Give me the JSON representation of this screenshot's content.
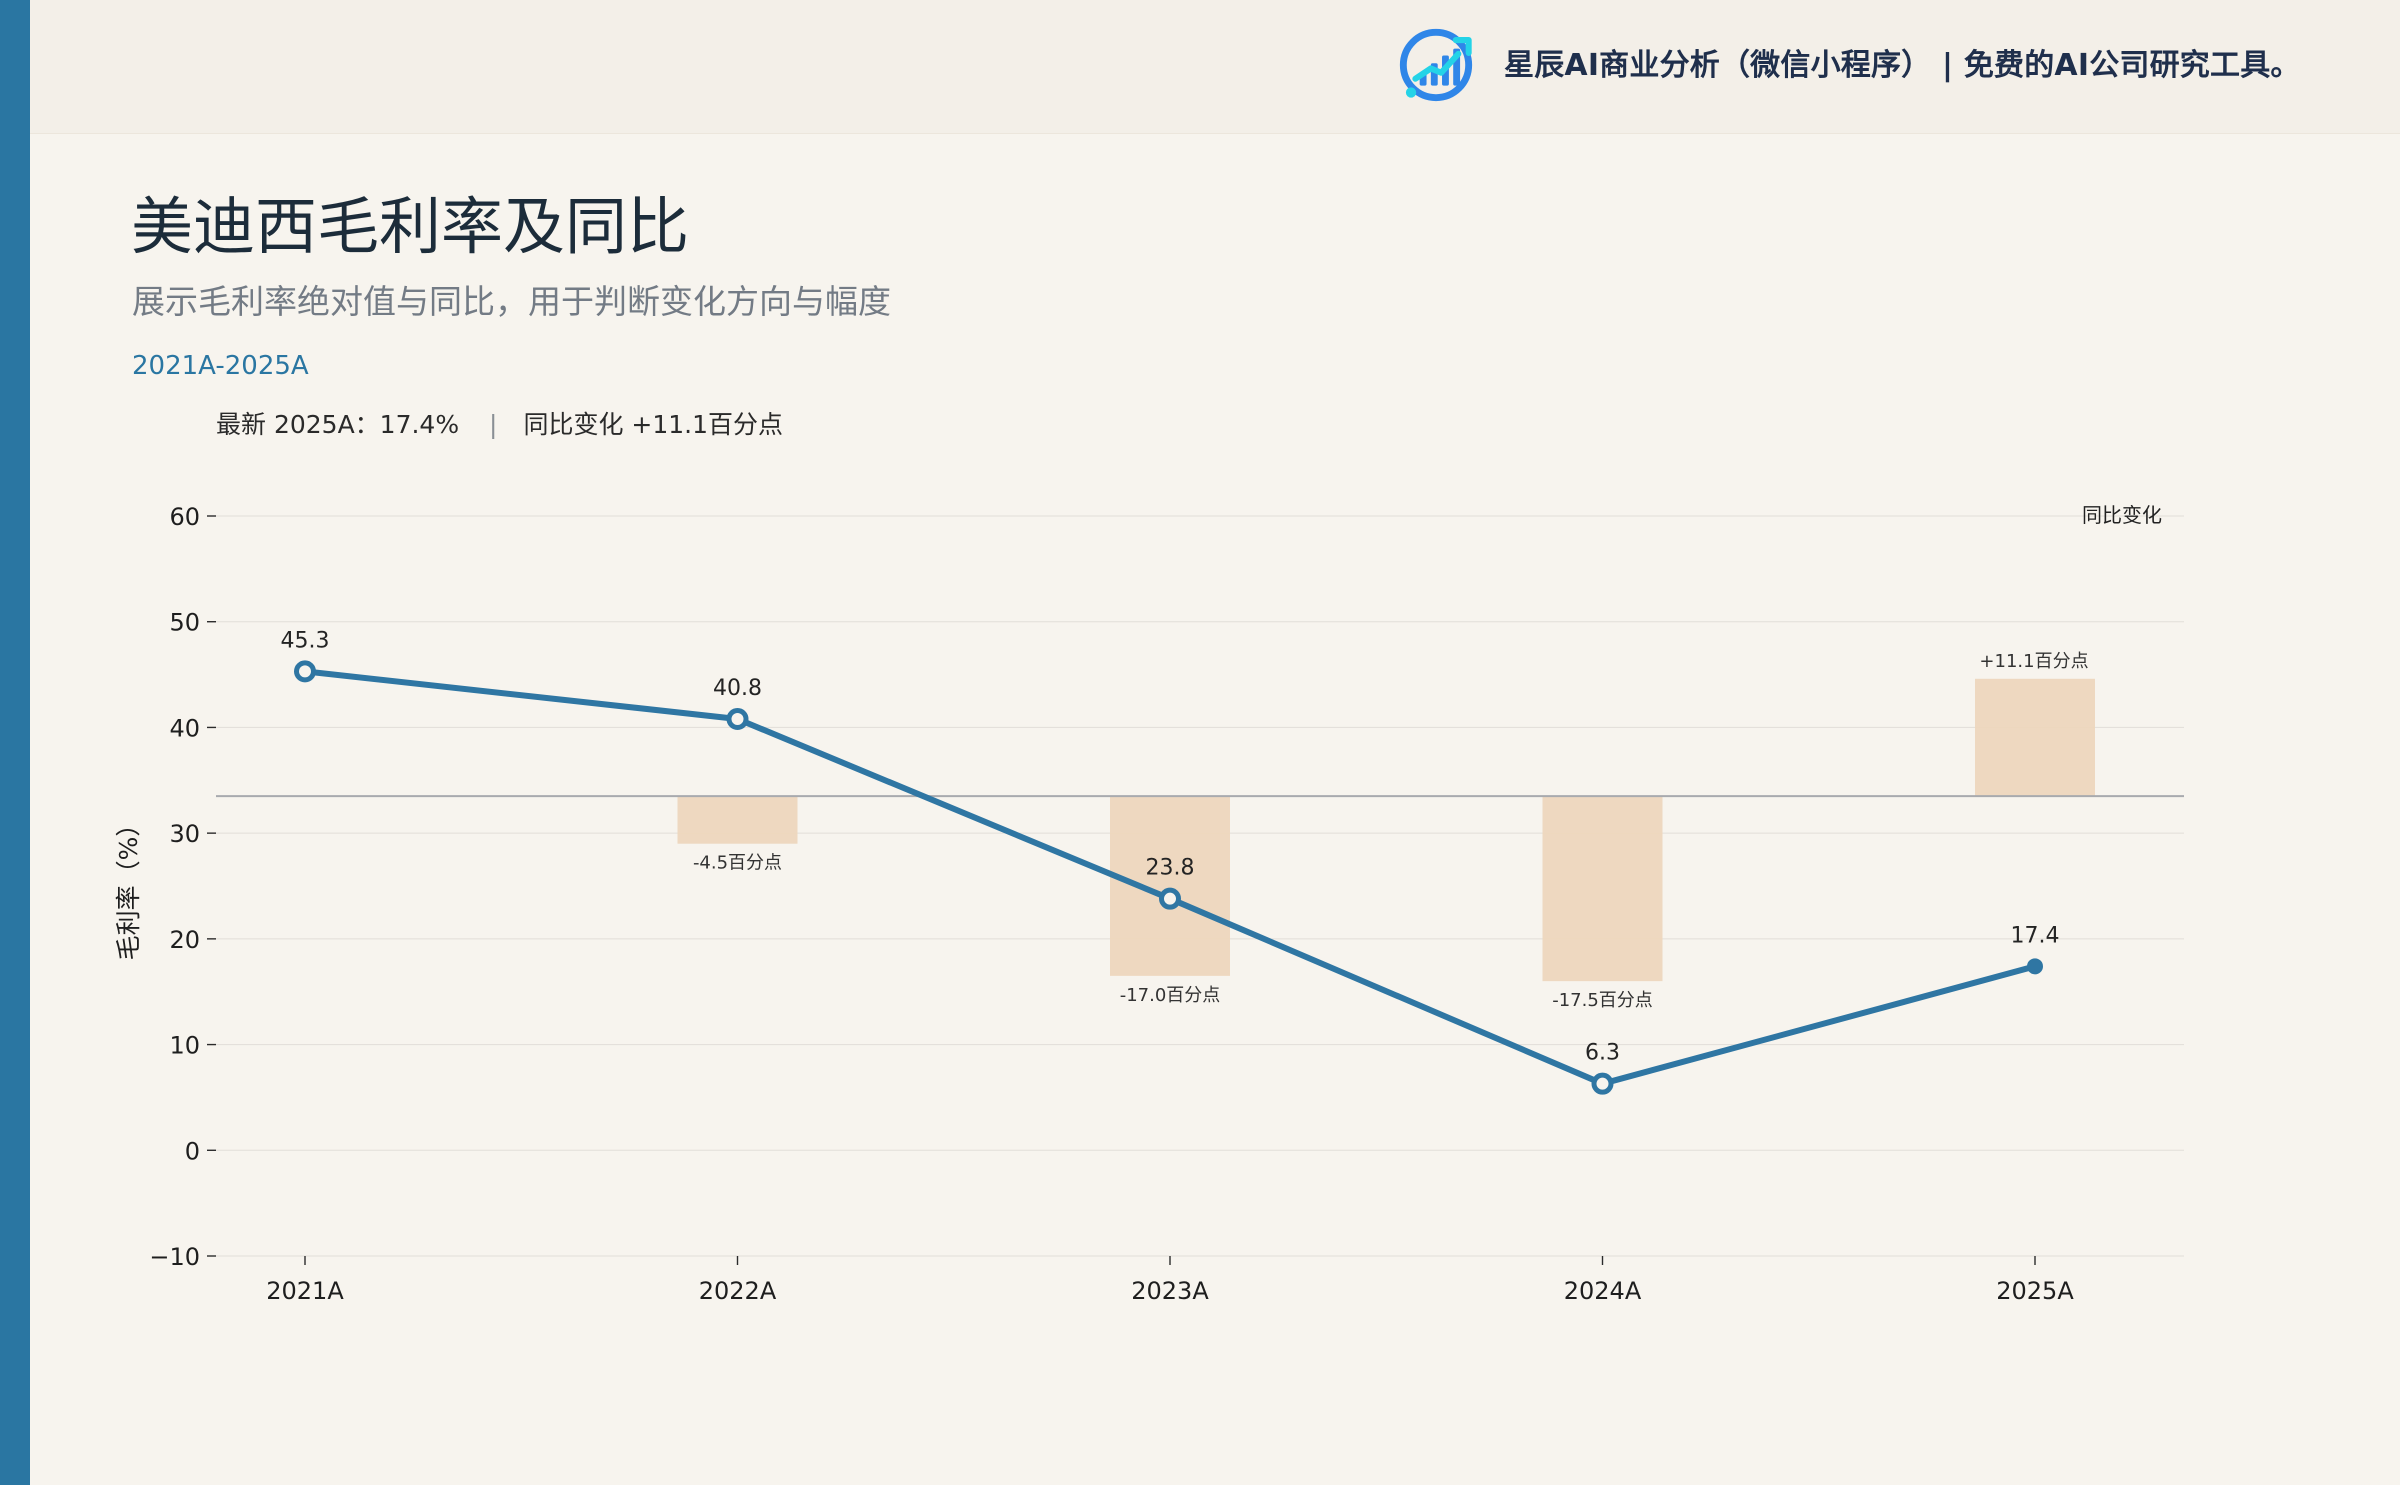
{
  "brand": {
    "logo_icon": "chart-bars-logo-icon",
    "text": "星辰AI商业分析（微信小程序）  |  免费的AI公司研究工具。"
  },
  "header": {
    "title": "美迪西毛利率及同比",
    "subtitle": "展示毛利率绝对值与同比，用于判断变化方向与幅度",
    "period": "2021A-2025A"
  },
  "summary": {
    "latest": "最新 2025A：17.4%",
    "separator": "|",
    "change": "同比变化 +11.1百分点"
  },
  "colors": {
    "accent": "#2a76a2",
    "line": "#2f76a3",
    "bar": "#edd6bd",
    "background": "#f7f4ee",
    "topbar": "#f3efe8",
    "grid": "#e2ded8",
    "zero_line": "#a8aaae"
  },
  "chart_data": {
    "type": "line",
    "title": "美迪西毛利率及同比",
    "subtitle": "展示毛利率绝对值与同比，用于判断变化方向与幅度",
    "categories": [
      "2021A",
      "2022A",
      "2023A",
      "2024A",
      "2025A"
    ],
    "series": [
      {
        "values": [
          45.3,
          40.8,
          23.8,
          6.3,
          17.4
        ],
        "labels": [
          "45.3",
          "40.8",
          "23.8",
          "6.3",
          "17.4"
        ]
      },
      {
        "name": "同比变化",
        "type": "bar",
        "values": [
          null,
          -4.5,
          -17.0,
          -17.5,
          11.1
        ],
        "labels": [
          "",
          "-4.5百分点",
          "-17.0百分点",
          "-17.5百分点",
          "+11.1百分点"
        ]
      }
    ],
    "ylabel": "毛利率（%）",
    "xlabel": "",
    "ylim": [
      -10,
      60
    ],
    "yticks": [
      -10,
      0,
      10,
      20,
      30,
      40,
      50,
      60
    ],
    "ytick_labels": [
      "−10",
      "0",
      "10",
      "20",
      "30",
      "40",
      "50",
      "60"
    ],
    "grid": true,
    "legend": {
      "position": "top-right",
      "label": "同比变化"
    }
  }
}
